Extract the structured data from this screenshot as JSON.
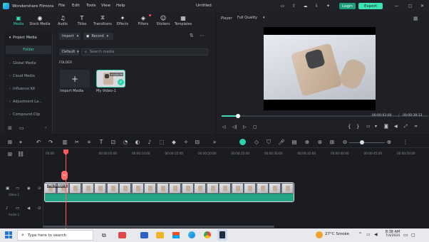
{
  "app": {
    "name": "Wondershare Filmora",
    "project_title": "Untitled",
    "login": "Login",
    "export": "Export"
  },
  "menu": [
    "File",
    "Edit",
    "Tools",
    "View",
    "Help"
  ],
  "tabs": [
    {
      "label": "Media",
      "icon": "media-icon"
    },
    {
      "label": "Stock Media",
      "icon": "stock-media-icon"
    },
    {
      "label": "Audio",
      "icon": "audio-icon"
    },
    {
      "label": "Titles",
      "icon": "titles-icon"
    },
    {
      "label": "Transitions",
      "icon": "transitions-icon"
    },
    {
      "label": "Effects",
      "icon": "effects-icon"
    },
    {
      "label": "Filters",
      "icon": "filters-icon"
    },
    {
      "label": "Stickers",
      "icon": "stickers-icon"
    },
    {
      "label": "Templates",
      "icon": "templates-icon"
    }
  ],
  "sidebar": {
    "project_media": "Project Media",
    "folder": "Folder",
    "items": [
      "Global Media",
      "Cloud Media",
      "Influence Kit",
      "Adjustment La...",
      "Compound Clip"
    ]
  },
  "media": {
    "import_btn": "Import",
    "record_btn": "Record",
    "sort": "Default",
    "search_placeholder": "Search media",
    "folder_label": "FOLDER",
    "import_tile": "Import Media",
    "clip_name": "My Video-1",
    "clip_duration": "00:00:39"
  },
  "player": {
    "label": "Player",
    "quality": "Full Quality",
    "current_time": "00:00:03:00",
    "total_time": "00:00:39:13",
    "progress": 0.08
  },
  "timeline": {
    "ticks": [
      "00:00",
      "00:00:05:00",
      "00:00:10:00",
      "00:00:15:00",
      "00:00:20:00",
      "00:00:25:00",
      "00:00:30:00",
      "00:00:35:00",
      "00:00:40:00",
      "00:00:45:00",
      "00:00:50:00",
      "00:00:55:00"
    ],
    "video_track": "Video 1",
    "audio_track": "Audio 1",
    "clip_label": "My Video-1"
  },
  "taskbar": {
    "search_placeholder": "Type here to search",
    "weather": "27°C  Smoke",
    "time": "8:38 AM",
    "date": "7/4/2024"
  }
}
